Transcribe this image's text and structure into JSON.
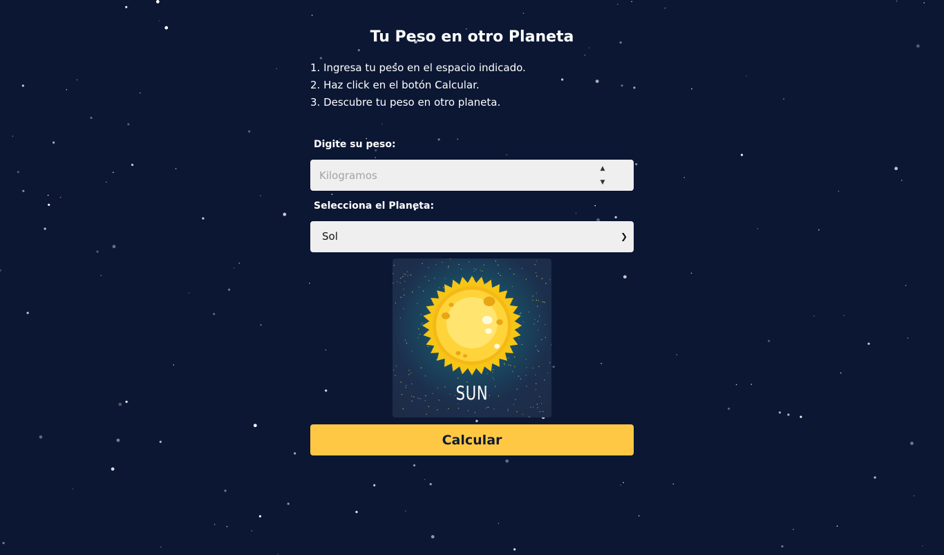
{
  "page": {
    "title": "Tu Peso en otro Planeta",
    "instructions": [
      "1. Ingresa tu peso en el espacio indicado.",
      "2. Haz click en el botón Calcular.",
      "3. Descubre tu peso en otro planeta."
    ]
  },
  "form": {
    "weight_label": "Digite su peso:",
    "weight_placeholder": "Kilogramos",
    "weight_value": "",
    "planet_label": "Selecciona el Planeta:",
    "planet_selected": "Sol",
    "button_label": "Calcular"
  },
  "planet_image": {
    "caption": "SUN",
    "icon": "sun-illustration"
  },
  "colors": {
    "background": "#0b1733",
    "button": "#ffc844",
    "input_bg": "#efefef",
    "sun_outer": "#f7c515",
    "sun_inner": "#ffe46f",
    "sun_core": "#fff2a8"
  }
}
